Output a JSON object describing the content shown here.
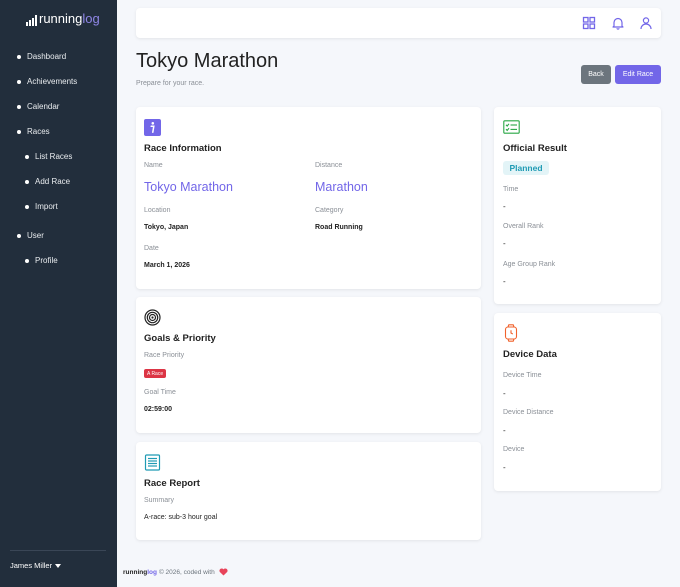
{
  "brand": {
    "part1": "running",
    "part2": "log"
  },
  "sidebar": {
    "items": [
      {
        "label": "Dashboard"
      },
      {
        "label": "Achievements"
      },
      {
        "label": "Calendar"
      },
      {
        "label": "Races"
      },
      {
        "label": "List Races"
      },
      {
        "label": "Add Race"
      },
      {
        "label": "Import"
      },
      {
        "label": "User"
      },
      {
        "label": "Profile"
      }
    ],
    "user_name": "James Miller"
  },
  "topbar": {
    "icons": [
      "apps-grid-icon",
      "bell-icon",
      "user-icon"
    ]
  },
  "page": {
    "title": "Tokyo Marathon",
    "subtitle": "Prepare for your race."
  },
  "buttons": {
    "back": "Back",
    "edit": "Edit Race"
  },
  "race_info": {
    "title": "Race Information",
    "name_label": "Name",
    "name": "Tokyo Marathon",
    "distance_label": "Distance",
    "distance": "Marathon",
    "location_label": "Location",
    "location": "Tokyo, Japan",
    "category_label": "Category",
    "category": "Road Running",
    "date_label": "Date",
    "date": "March 1, 2026"
  },
  "goals": {
    "title": "Goals & Priority",
    "priority_label": "Race Priority",
    "priority_badge": "A Race",
    "goal_time_label": "Goal Time",
    "goal_time": "02:59:00"
  },
  "report": {
    "title": "Race Report",
    "summary_label": "Summary",
    "summary": "A-race: sub-3 hour goal"
  },
  "result": {
    "title": "Official Result",
    "status": "Planned",
    "time_label": "Time",
    "time": "-",
    "overall_rank_label": "Overall Rank",
    "overall_rank": "-",
    "age_group_rank_label": "Age Group Rank",
    "age_group_rank": "-"
  },
  "device": {
    "title": "Device Data",
    "time_label": "Device Time",
    "time": "-",
    "distance_label": "Device Distance",
    "distance": "-",
    "device_label": "Device",
    "device": "-"
  },
  "footer": {
    "brand1": "running",
    "brand2": "log",
    "text": "© 2026, coded with"
  },
  "colors": {
    "accent": "#7266e8",
    "sidebar": "#222e3c",
    "teal": "#1f9bb4",
    "danger": "#dc3545"
  }
}
